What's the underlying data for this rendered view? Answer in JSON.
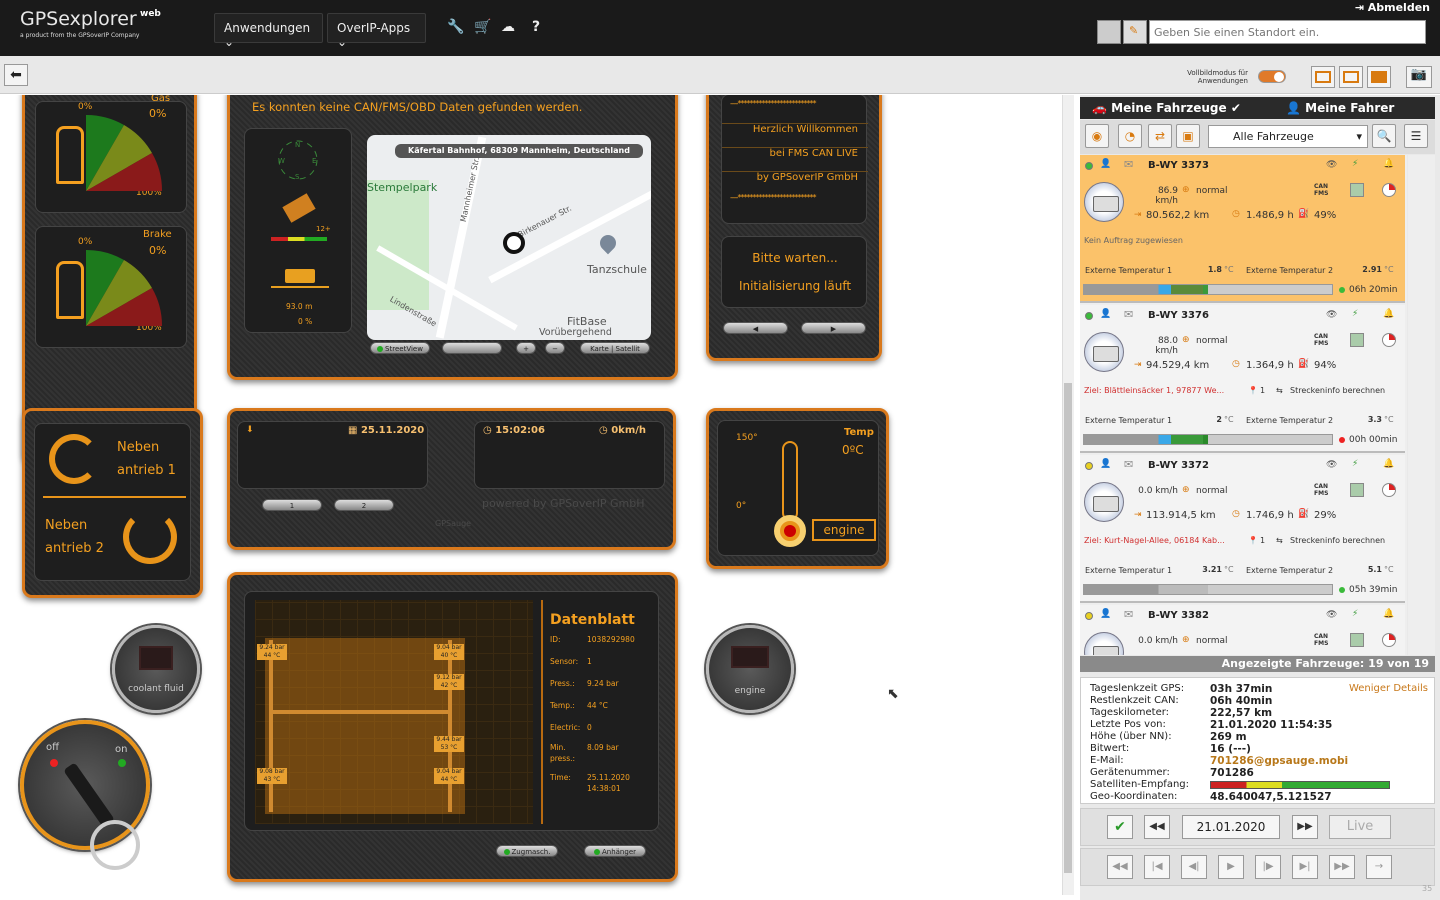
{
  "topbar": {
    "logo_main": "GPSexplorer",
    "logo_sup": "web",
    "logo_sub": "a product from the GPSoverIP Company",
    "menu_apps": "Anwendungen",
    "menu_overip": "OverIP-Apps",
    "logout": "Abmelden",
    "location_placeholder": "Geben Sie einen Standort ein."
  },
  "toolbar": {
    "vollbild": "Vollbildmodus für Anwendungen"
  },
  "dash": {
    "gas_label": "Gas",
    "gas_value": "0%",
    "gas_min": "0%",
    "gas_max": "100%",
    "brake_label": "Brake",
    "brake_value": "0%",
    "brake_min": "0%",
    "brake_max": "100%",
    "can_message": "Es konnten keine CAN/FMS/OBD Daten gefunden werden.",
    "sat_count": "12+",
    "height": "93.0 m",
    "slope": "0 %",
    "map_address": "Käfertal Bahnhof, 68309 Mannheim, Deutschland",
    "map_labels": [
      "Stempelpark",
      "Tanzschule",
      "FitBase",
      "Vorübergehend",
      "Lindenstraße",
      "Birkenauer Str.",
      "Mannheimer Str."
    ],
    "btn_streetview": "StreetView",
    "btn_karte": "Karte | Satellit",
    "welcome": [
      "Herzlich Willkommen",
      "bei FMS CAN LIVE",
      "by GPSoverIP GmbH"
    ],
    "status1": "Bitte warten...",
    "status2": "Initialisierung läuft",
    "neben1": "Neben antrieb 1",
    "neben2": "Neben antrieb 2",
    "date": "25.11.2020",
    "time": "15:02:06",
    "speed": "0km/h",
    "btn1": "1",
    "btn2": "2",
    "powered": "powered by GPSoverIP GmbH",
    "gpsauge": "GPSauge",
    "temp_label": "Temp",
    "temp_value": "0ºC",
    "temp_scale_top": "150°",
    "temp_scale_bottom": "0°",
    "engine_label": "engine",
    "coolant": "coolant fluid",
    "engine_lamp": "engine",
    "key_off": "off",
    "key_on": "on",
    "datasheet": {
      "title": "Datenblatt",
      "rows": [
        [
          "ID:",
          "1038292980"
        ],
        [
          "Sensor:",
          "1"
        ],
        [
          "Press.:",
          "9.24 bar"
        ],
        [
          "Temp.:",
          "44 °C"
        ],
        [
          "Electric:",
          "0"
        ],
        [
          "Min. press.:",
          "8.09 bar"
        ],
        [
          "Time:",
          "25.11.2020 14:38:01"
        ]
      ]
    },
    "tires": [
      [
        "9.24 bar",
        "44 °C"
      ],
      [
        "9.04 bar",
        "40 °C"
      ],
      [
        "9.12 bar",
        "42 °C"
      ],
      [
        "9.44 bar",
        "53 °C"
      ],
      [
        "9.08 bar",
        "43 °C"
      ],
      [
        "9.04 bar",
        "44 °C"
      ]
    ],
    "btn_zugmasch": "Zugmasch.",
    "btn_anhaenger": "Anhänger"
  },
  "sidebar": {
    "tab_vehicles": "Meine Fahrzeuge",
    "tab_drivers": "Meine Fahrer",
    "fleet_select": "Alle Fahrzeuge",
    "vehicles": [
      {
        "plate": "B-WY 3373",
        "speed": "86.9 km/h",
        "state": "normal",
        "km": "80.562,2 km",
        "hours": "1.486,9 h",
        "pct": "49%",
        "note": "Kein Auftrag zugewiesen",
        "ext1": "1.8",
        "ext2": "2.91",
        "ext_unit": "°C",
        "duration": "06h 20min",
        "target": "",
        "target_n": "",
        "streckeninfo": ""
      },
      {
        "plate": "B-WY 3376",
        "speed": "88.0 km/h",
        "state": "normal",
        "km": "94.529,4 km",
        "hours": "1.364,9 h",
        "pct": "94%",
        "note": "",
        "ext1": "2",
        "ext2": "3.3",
        "ext_unit": "°C",
        "duration": "00h 00min",
        "target": "Ziel: Blättleinsäcker 1, 97877 We...",
        "target_n": "1",
        "streckeninfo": "Streckeninfo berechnen"
      },
      {
        "plate": "B-WY 3372",
        "speed": "0.0 km/h",
        "state": "normal",
        "km": "113.914,5 km",
        "hours": "1.746,9 h",
        "pct": "29%",
        "note": "",
        "ext1": "3.21",
        "ext2": "5.1",
        "ext_unit": "°C",
        "duration": "05h 39min",
        "target": "Ziel: Kurt-Nagel-Allee, 06184 Kab...",
        "target_n": "1",
        "streckeninfo": "Streckeninfo berechnen"
      },
      {
        "plate": "B-WY 3382",
        "speed": "0.0 km/h",
        "state": "normal",
        "km": "",
        "hours": "",
        "pct": "",
        "note": "",
        "ext1": "",
        "ext2": "",
        "ext_unit": "",
        "duration": "",
        "target": "",
        "target_n": "",
        "streckeninfo": ""
      }
    ],
    "ext_label1": "Externe Temperatur 1",
    "ext_label2": "Externe Temperatur 2",
    "can_label": "CAN FMS",
    "shown": "Angezeigte Fahrzeuge: 19 von 19",
    "less_details": "Weniger Details",
    "details": [
      [
        "Tageslenkzeit GPS:",
        "03h 37min"
      ],
      [
        "Restlenkzeit CAN:",
        "06h 40min"
      ],
      [
        "Tageskilometer:",
        "222,57 km"
      ],
      [
        "Letzte Pos von:",
        "21.01.2020 11:54:35"
      ],
      [
        "Höhe (über NN):",
        "269 m"
      ],
      [
        "Bitwert:",
        "16 (---)"
      ],
      [
        "E-Mail:",
        "701286@gpsauge.mobi"
      ],
      [
        "Gerätenummer:",
        "701286"
      ],
      [
        "Satelliten-Empfang:",
        ""
      ],
      [
        "Geo-Koordinaten:",
        "48.640047,5.121527"
      ]
    ],
    "date": "21.01.2020",
    "live": "Live",
    "version": "35"
  }
}
